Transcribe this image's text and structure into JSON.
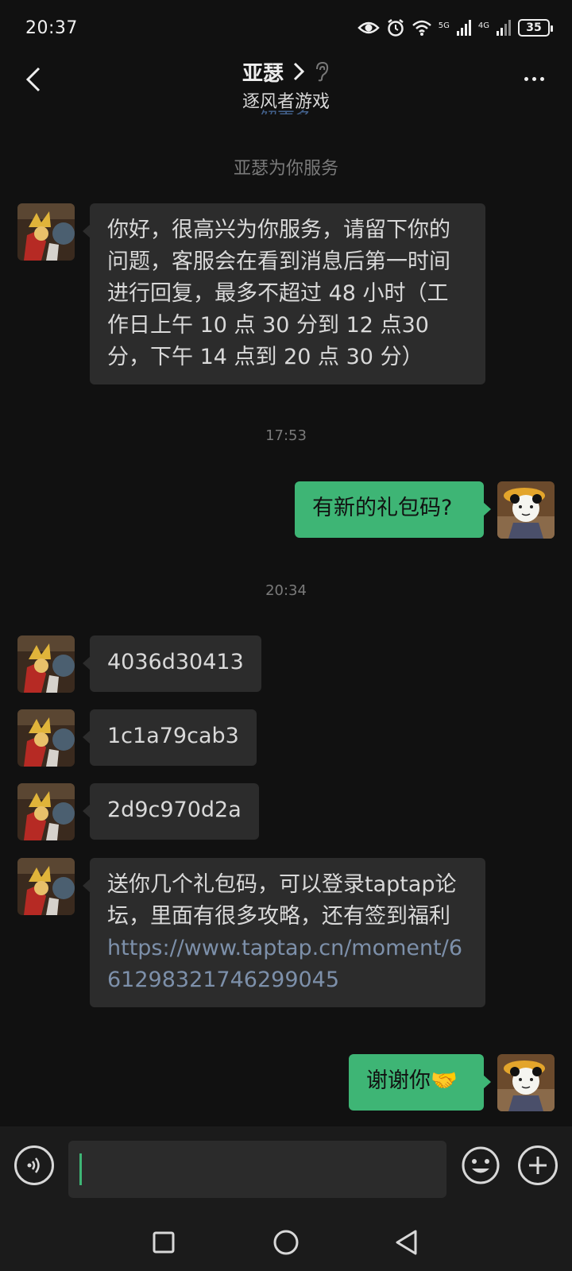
{
  "status_bar": {
    "time": "20:37",
    "signal_5g": "5G",
    "signal_4g": "4G",
    "battery": "35"
  },
  "header": {
    "title": "亚瑟",
    "subtitle": "逐风者游戏",
    "ghost_text": "解更多"
  },
  "chat": {
    "system_notice": "亚瑟为你服务",
    "messages": [
      {
        "side": "in",
        "text": "你好，很高兴为你服务，请留下你的问题，客服会在看到消息后第一时间进行回复，最多不超过 48 小时（工作日上午 10 点 30 分到 12 点30分，下午 14 点到 20 点 30 分）"
      },
      {
        "timestamp": "17:53"
      },
      {
        "side": "out",
        "text": "有新的礼包码?"
      },
      {
        "timestamp": "20:34"
      },
      {
        "side": "in",
        "text": "4036d30413"
      },
      {
        "side": "in",
        "text": "1c1a79cab3"
      },
      {
        "side": "in",
        "text": "2d9c970d2a"
      },
      {
        "side": "in",
        "text": "送你几个礼包码，可以登录taptap论坛，里面有很多攻略，还有签到福利",
        "link": "https://www.taptap.cn/moment/661298321746299045"
      },
      {
        "side": "out",
        "text": "谢谢你🤝"
      }
    ]
  },
  "colors": {
    "background": "#111111",
    "incoming_bubble": "#2c2c2c",
    "outgoing_bubble": "#3eb575",
    "link": "#7d90aa"
  },
  "icons": {
    "back": "chevron-left-icon",
    "more": "more-dots-icon",
    "voice": "voice-icon",
    "emoji": "emoji-icon",
    "plus": "plus-icon",
    "nav_recent": "square-icon",
    "nav_home": "circle-icon",
    "nav_back": "triangle-back-icon"
  }
}
